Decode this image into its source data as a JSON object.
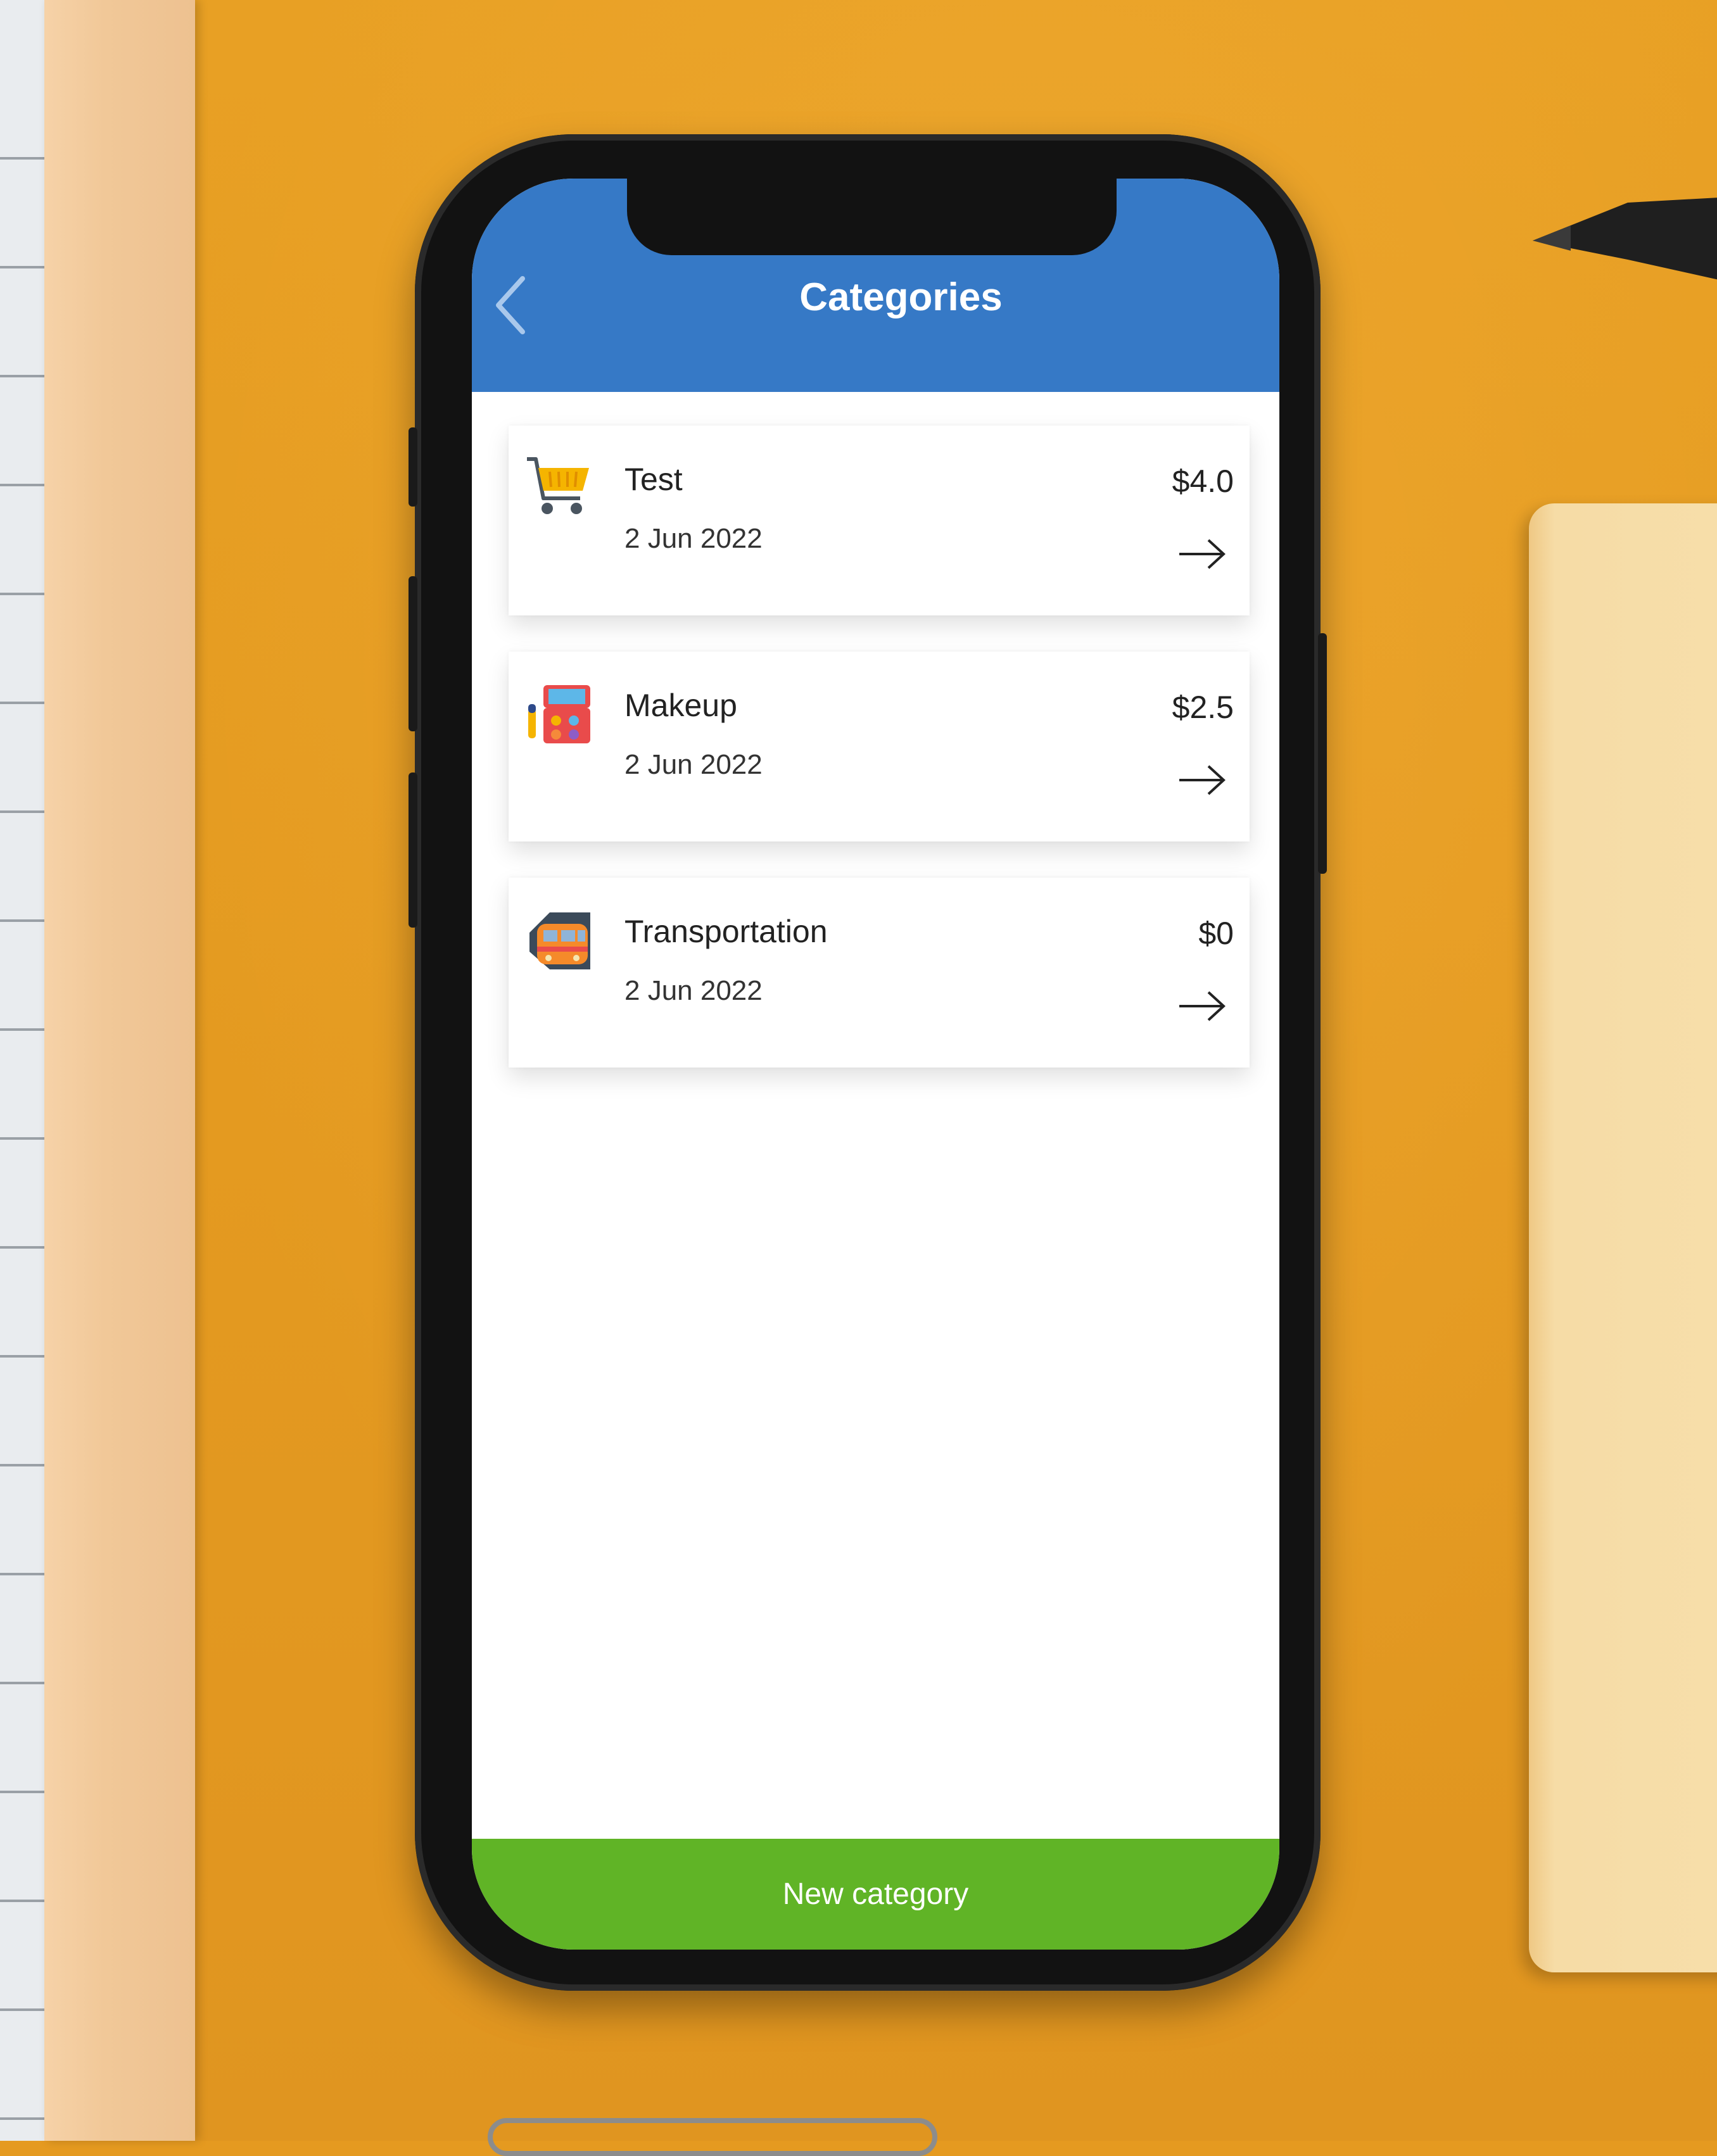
{
  "app": {
    "header": {
      "title": "Categories",
      "back_icon": "chevron-left-icon"
    },
    "categories": [
      {
        "name": "Test",
        "date": "2 Jun 2022",
        "amount": "$4.0",
        "icon": "shopping-cart-icon"
      },
      {
        "name": "Makeup",
        "date": "2 Jun 2022",
        "amount": "$2.5",
        "icon": "makeup-palette-icon"
      },
      {
        "name": "Transportation",
        "date": "2 Jun 2022",
        "amount": "$0",
        "icon": "train-icon"
      }
    ],
    "footer": {
      "new_category_label": "New category"
    }
  },
  "colors": {
    "header": "#3679C6",
    "button": "#60B426",
    "background": "#E59A20"
  }
}
